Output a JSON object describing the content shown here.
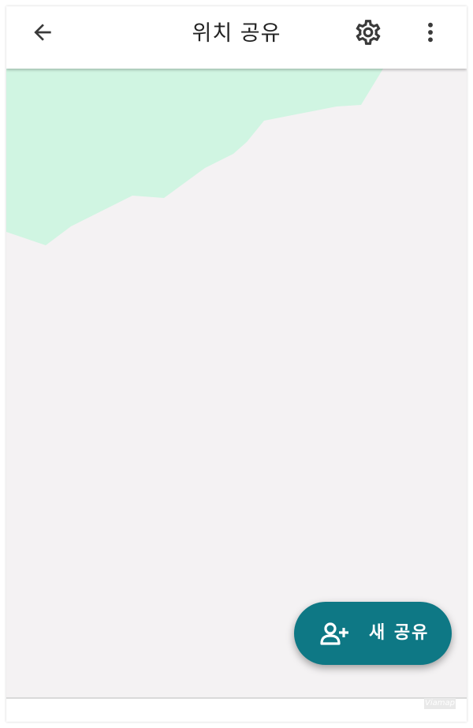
{
  "header": {
    "title": "위치 공유",
    "back_icon": "arrow-left-icon",
    "settings_icon": "gear-icon",
    "more_icon": "more-vertical-icon"
  },
  "map": {
    "colors": {
      "land": "#f4f2f3",
      "park": "#d0f5e2"
    },
    "attribution": "Viamap"
  },
  "fab": {
    "label": "새 공유",
    "icon": "person-add-icon",
    "color": "#0e7885"
  }
}
